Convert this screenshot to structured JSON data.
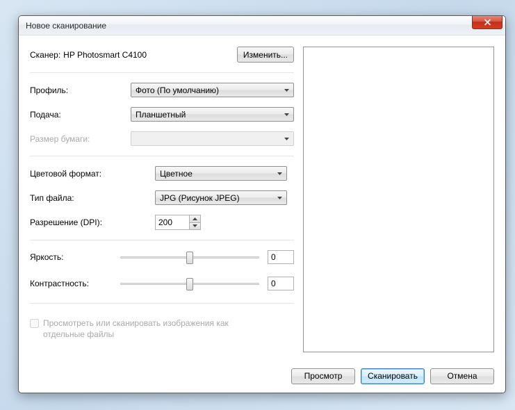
{
  "window": {
    "title": "Новое сканирование"
  },
  "scanner": {
    "label": "Сканер:",
    "name": "HP Photosmart C4100",
    "change": "Изменить..."
  },
  "fields": {
    "profile": {
      "label": "Профиль:",
      "value": "Фото (По умолчанию)"
    },
    "source": {
      "label": "Подача:",
      "value": "Планшетный"
    },
    "paper": {
      "label": "Размер бумаги:",
      "value": ""
    },
    "colorfmt": {
      "label": "Цветовой формат:",
      "value": "Цветное"
    },
    "filetype": {
      "label": "Тип файла:",
      "value": "JPG (Рисунок JPEG)"
    },
    "dpi": {
      "label": "Разрешение (DPI):",
      "value": "200"
    }
  },
  "sliders": {
    "brightness": {
      "label": "Яркость:",
      "value": "0"
    },
    "contrast": {
      "label": "Контрастность:",
      "value": "0"
    }
  },
  "checkbox": {
    "label": "Просмотреть или сканировать изображения как отдельные файлы",
    "checked": false
  },
  "buttons": {
    "preview": "Просмотр",
    "scan": "Сканировать",
    "cancel": "Отмена"
  }
}
